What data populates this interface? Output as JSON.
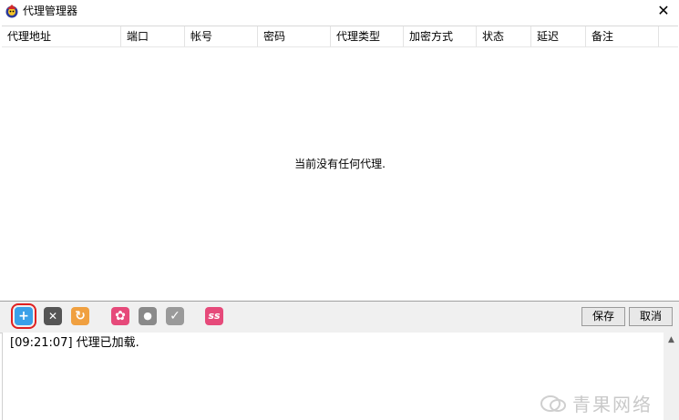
{
  "window": {
    "title": "代理管理器",
    "close_glyph": "✕"
  },
  "table": {
    "columns": [
      "代理地址",
      "端口",
      "帐号",
      "密码",
      "代理类型",
      "加密方式",
      "状态",
      "延迟",
      "备注"
    ],
    "empty_message": "当前没有任何代理."
  },
  "toolbar": {
    "icons": [
      {
        "name": "add-proxy-icon",
        "glyph": "+",
        "color": "#3aa0e8"
      },
      {
        "name": "delete-proxy-icon",
        "glyph": "✕",
        "color": "#555555"
      },
      {
        "name": "refresh-icon",
        "glyph": "↻",
        "color": "#f0a040"
      },
      {
        "name": "settings-gear-icon",
        "glyph": "✿",
        "color": "#e64a7a"
      },
      {
        "name": "lightbulb-icon",
        "glyph": "●",
        "color": "#8a8a8a"
      },
      {
        "name": "check-icon",
        "glyph": "✓",
        "color": "#9a9a9a"
      },
      {
        "name": "ss-icon",
        "glyph": "ss",
        "color": "#e64a7a"
      }
    ],
    "save_label": "保存",
    "cancel_label": "取消"
  },
  "log": {
    "lines": [
      "[09:21:07] 代理已加载."
    ]
  },
  "watermark": {
    "text": "青果网络"
  }
}
